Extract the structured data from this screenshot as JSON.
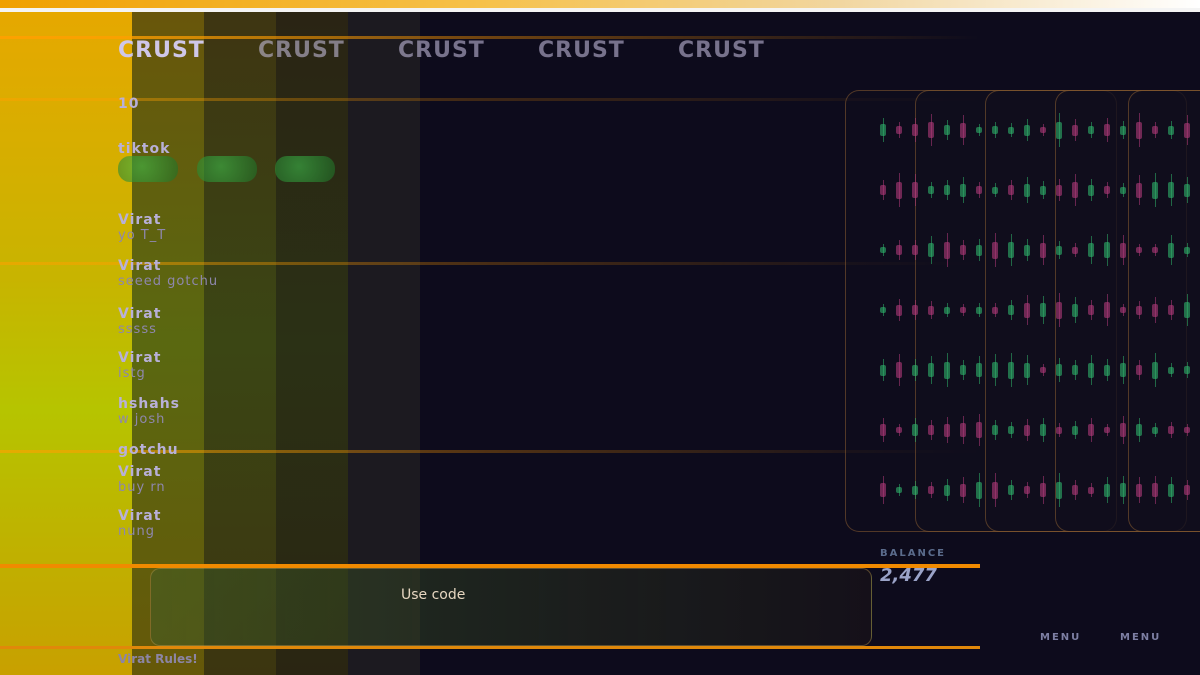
{
  "header": {
    "ghost_text": "CRUST"
  },
  "counter_row": "10",
  "rows": [
    {
      "user": "Virat",
      "message": "tiktok",
      "kind": "label"
    },
    {
      "user": "Virat",
      "message": "yo T_T"
    },
    {
      "user": "Virat",
      "message": "seeed gotchu"
    },
    {
      "user": "Virat",
      "message": "sssss"
    },
    {
      "user": "Virat",
      "message": "istg"
    },
    {
      "user": "hshahs",
      "message": "w josh"
    },
    {
      "user": "gotchu",
      "message": "gotchu"
    },
    {
      "user": "Virat",
      "message": "buy rn"
    },
    {
      "user": "Virat",
      "message": "nung"
    }
  ],
  "balance": {
    "label": "BALANCE",
    "value": "2,477"
  },
  "promo": {
    "code_text": "Use code",
    "menu_label": "MENU"
  },
  "footer": {
    "text": "Virat Rules!"
  },
  "colors": {
    "accent": "#f08a00",
    "bull": "#2fb36a",
    "bear": "#b03a7a"
  }
}
